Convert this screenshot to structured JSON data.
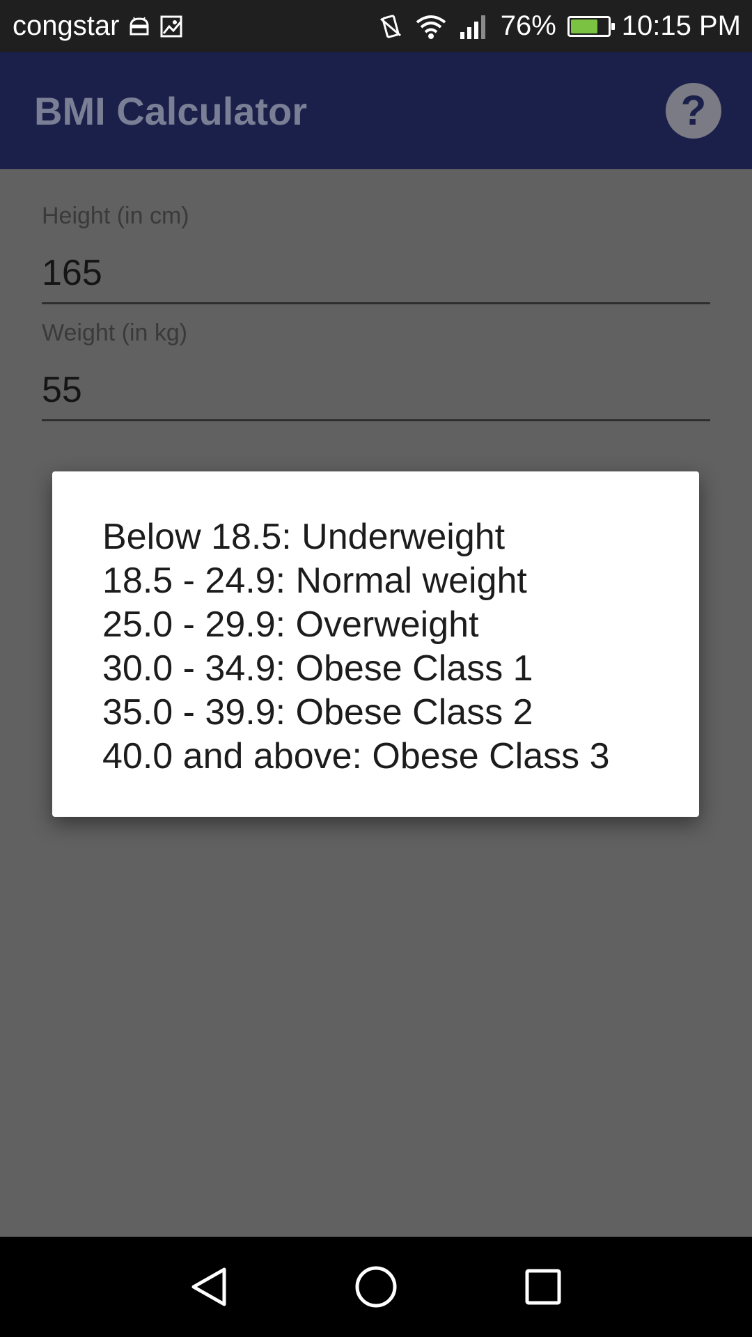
{
  "status_bar": {
    "carrier": "congstar",
    "battery_percent": "76%",
    "battery_level": 0.76,
    "time": "10:15 PM",
    "icons": [
      "android-icon",
      "image-icon",
      "vibrate-icon",
      "wifi-icon",
      "signal-icon",
      "battery-charging-icon"
    ]
  },
  "app_bar": {
    "title": "BMI Calculator",
    "help_icon": "help-icon",
    "help_label": "?"
  },
  "form": {
    "height_label": "Height (in cm)",
    "height_value": "165",
    "weight_label": "Weight (in kg)",
    "weight_value": "55"
  },
  "dialog": {
    "lines": [
      "Below 18.5: Underweight",
      "18.5 - 24.9: Normal weight",
      "25.0 - 29.9: Overweight",
      "30.0 - 34.9: Obese Class 1",
      "35.0 - 39.9: Obese Class 2",
      "40.0 and above: Obese Class 3"
    ]
  },
  "nav_bar": {
    "buttons": [
      "back-icon",
      "home-icon",
      "recents-icon"
    ]
  },
  "colors": {
    "app_bar": "#1a2049",
    "scrim_background": "#616161",
    "dialog_background": "#ffffff",
    "battery_fill": "#7cc242"
  }
}
